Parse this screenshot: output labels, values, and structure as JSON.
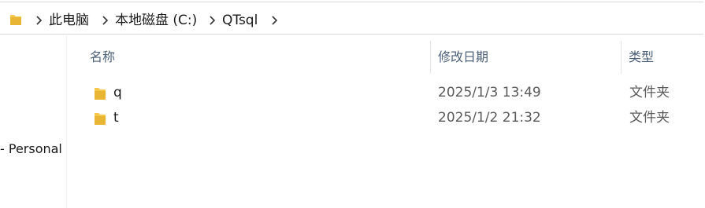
{
  "breadcrumb": {
    "items": [
      {
        "label": "此电脑"
      },
      {
        "label": "本地磁盘 (C:)"
      },
      {
        "label": "QTsql"
      }
    ]
  },
  "nav": {
    "partial_item": "- Personal"
  },
  "columns": {
    "name": "名称",
    "date": "修改日期",
    "type": "类型"
  },
  "files": [
    {
      "name": "q",
      "date": "2025/1/3 13:49",
      "type": "文件夹",
      "icon": "folder-icon"
    },
    {
      "name": "t",
      "date": "2025/1/2 21:32",
      "type": "文件夹",
      "icon": "folder-icon"
    }
  ],
  "colors": {
    "folder_yellow": "#f6c94b",
    "header_text": "#4c607a"
  }
}
